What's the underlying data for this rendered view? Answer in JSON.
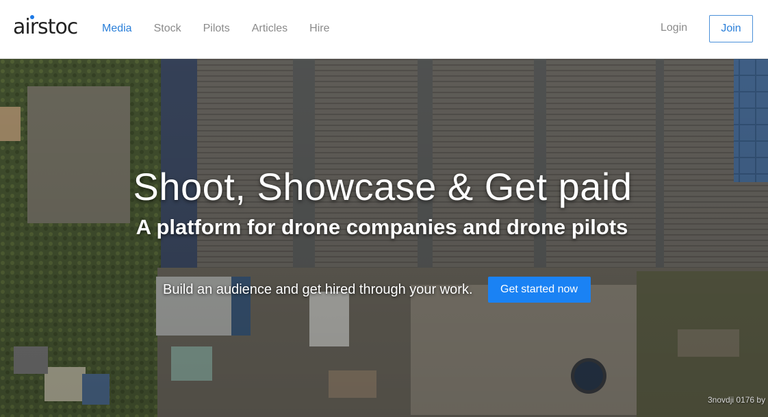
{
  "header": {
    "logo_text": "airstoc",
    "nav": {
      "media": "Media",
      "stock": "Stock",
      "pilots": "Pilots",
      "articles": "Articles",
      "hire": "Hire"
    },
    "login_label": "Login",
    "join_label": "Join",
    "accent_color": "#2a7fd9"
  },
  "hero": {
    "title": "Shoot, Showcase & Get paid",
    "subtitle": "A platform for drone companies and drone pilots",
    "cta_text": "Build an audience and get hired through your work.",
    "cta_button": "Get started now",
    "button_color": "#1a82f4",
    "image_credit": "3novdji 0176 by"
  }
}
